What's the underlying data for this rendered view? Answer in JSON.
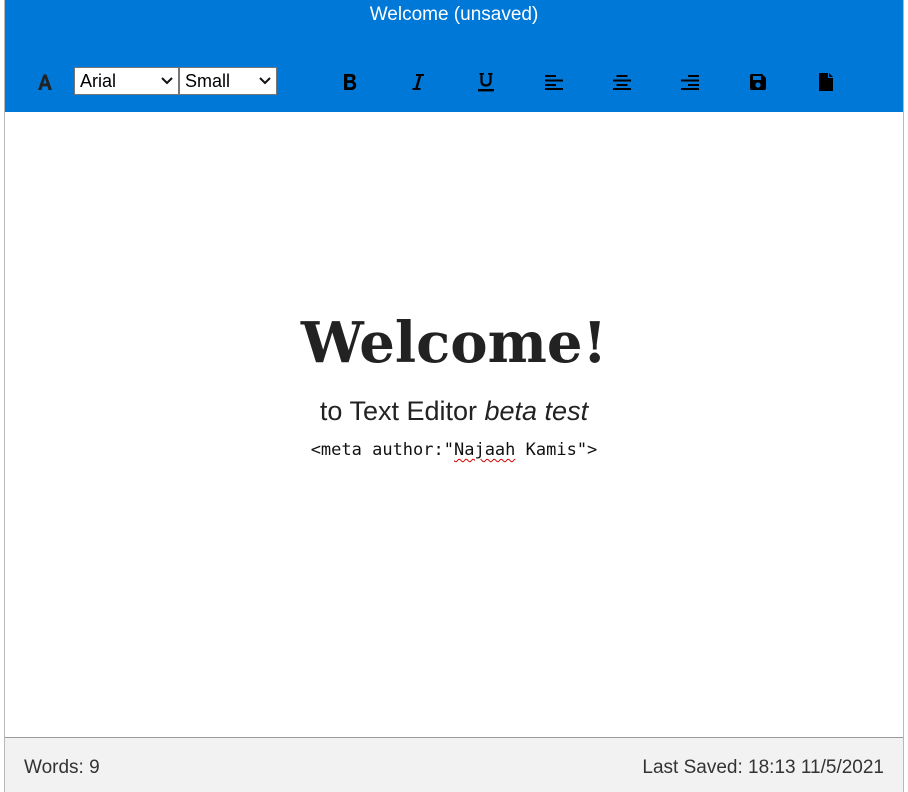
{
  "window": {
    "title": "Welcome (unsaved)"
  },
  "toolbar": {
    "font_color_icon": "font-color-icon",
    "font_family": {
      "selected": "Arial"
    },
    "font_size": {
      "selected": "Small"
    },
    "icons": {
      "bold": "bold-icon",
      "italic": "italic-icon",
      "underline": "underline-icon",
      "align_left": "align-left-icon",
      "align_center": "align-center-icon",
      "align_right": "align-right-icon",
      "save": "save-icon",
      "new_file": "file-icon"
    }
  },
  "document": {
    "heading": "Welcome!",
    "subtitle_plain": "to Text Editor ",
    "subtitle_italic": "beta test",
    "meta_prefix": "<meta author:\"",
    "meta_name_first": "Najaah",
    "meta_suffix": " Kamis\">"
  },
  "status": {
    "words": "Words: 9",
    "last_saved": "Last Saved: 18:13 11/5/2021"
  },
  "colors": {
    "accent": "#0078d7",
    "footer_bg": "#f2f2f2",
    "text": "#222222"
  }
}
